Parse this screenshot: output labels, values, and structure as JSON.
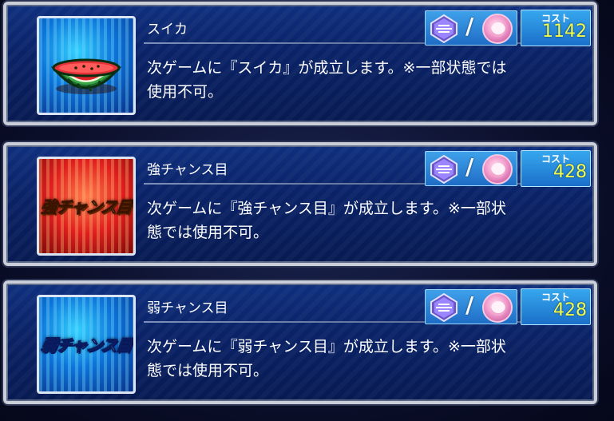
{
  "items": [
    {
      "thumb_variant": "watermelon",
      "thumb_label": "",
      "name": "スイカ",
      "description": "次ゲームに『スイカ』が成立します。※一部状態では\n使用不可。",
      "desc_line1": "次ゲームに『スイカ』が成立します。※一部状態では",
      "desc_line2": "使用不可。",
      "cost_label": "コスト",
      "cost": "1142",
      "separator": "/"
    },
    {
      "thumb_variant": "red",
      "thumb_label": "強チャンス目",
      "name": "強チャンス目",
      "desc_line1": "次ゲームに『強チャンス目』が成立します。※一部状",
      "desc_line2": "態では使用不可。",
      "cost_label": "コスト",
      "cost": "428",
      "separator": "/"
    },
    {
      "thumb_variant": "blue",
      "thumb_label": "弱チャンス目",
      "name": "弱チャンス目",
      "desc_line1": "次ゲームに『弱チャンス目』が成立します。※一部状",
      "desc_line2": "態では使用不可。",
      "cost_label": "コスト",
      "cost": "428",
      "separator": "/"
    }
  ],
  "icons": {
    "left": "crystal-icon",
    "right": "character-medal-icon"
  },
  "colors": {
    "cost_value": "#f2ff4a",
    "card_background": "#0a2266",
    "card_border": "#c9ced8"
  }
}
